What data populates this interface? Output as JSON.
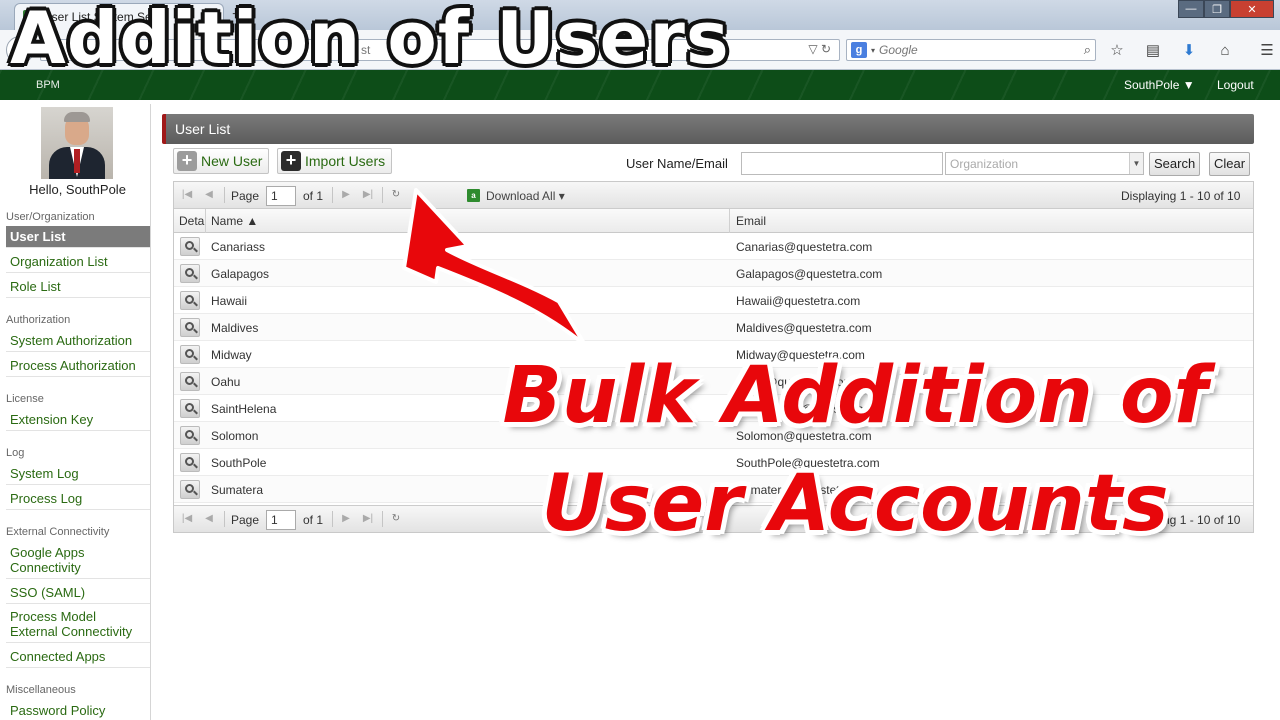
{
  "browser": {
    "tab_title": "User List System Setti",
    "tab_close": "×",
    "new_tab": "+",
    "url_text": "st",
    "search_engine": "g",
    "search_placeholder": "Google",
    "win_minimize": "—",
    "win_restore": "❐",
    "win_close": "✕"
  },
  "app_header": {
    "brand": "BPM",
    "user_menu": "SouthPole ▼",
    "logout": "Logout"
  },
  "sidebar": {
    "greeting": "Hello, SouthPole",
    "sections": [
      {
        "title": "User/Organization",
        "items": [
          "User List",
          "Organization List",
          "Role List"
        ]
      },
      {
        "title": "Authorization",
        "items": [
          "System Authorization",
          "Process Authorization"
        ]
      },
      {
        "title": "License",
        "items": [
          "Extension Key"
        ]
      },
      {
        "title": "Log",
        "items": [
          "System Log",
          "Process Log"
        ]
      },
      {
        "title": "External Connectivity",
        "items": [
          "Google Apps Connectivity",
          "SSO (SAML)",
          "Process Model External Connectivity",
          "Connected Apps"
        ]
      },
      {
        "title": "Miscellaneous",
        "items": [
          "Password Policy"
        ]
      }
    ],
    "active_item": "User List"
  },
  "panel": {
    "title": "User List",
    "new_user": "New User",
    "import_users": "Import Users",
    "filter_label": "User Name/Email",
    "org_placeholder": "Organization",
    "search_btn": "Search",
    "clear_btn": "Clear"
  },
  "pager": {
    "page_label": "Page",
    "page_value": "1",
    "of_label": "of 1",
    "download": "Download All ▾",
    "download_icon": "a",
    "displaying": "Displaying 1 - 10 of 10"
  },
  "grid": {
    "columns": [
      "Deta",
      "Name ▲",
      "Email"
    ],
    "rows": [
      {
        "name": "Canariass",
        "email": "Canarias@questetra.com"
      },
      {
        "name": "Galapagos",
        "email": "Galapagos@questetra.com"
      },
      {
        "name": "Hawaii",
        "email": "Hawaii@questetra.com"
      },
      {
        "name": "Maldives",
        "email": "Maldives@questetra.com"
      },
      {
        "name": "Midway",
        "email": "Midway@questetra.com"
      },
      {
        "name": "Oahu",
        "email": "Oahu@questetra.com"
      },
      {
        "name": "SaintHelena",
        "email": "SaintHelena@questetra.com"
      },
      {
        "name": "Solomon",
        "email": "Solomon@questetra.com"
      },
      {
        "name": "SouthPole",
        "email": "SouthPole@questetra.com"
      },
      {
        "name": "Sumatera",
        "email": "Sumatera@questetra.com"
      }
    ]
  },
  "overlay": {
    "title": "Addition of Users",
    "banner_line1": "Bulk Addition of",
    "banner_line2": "User Accounts",
    "arrow_color": "#e8070b"
  }
}
